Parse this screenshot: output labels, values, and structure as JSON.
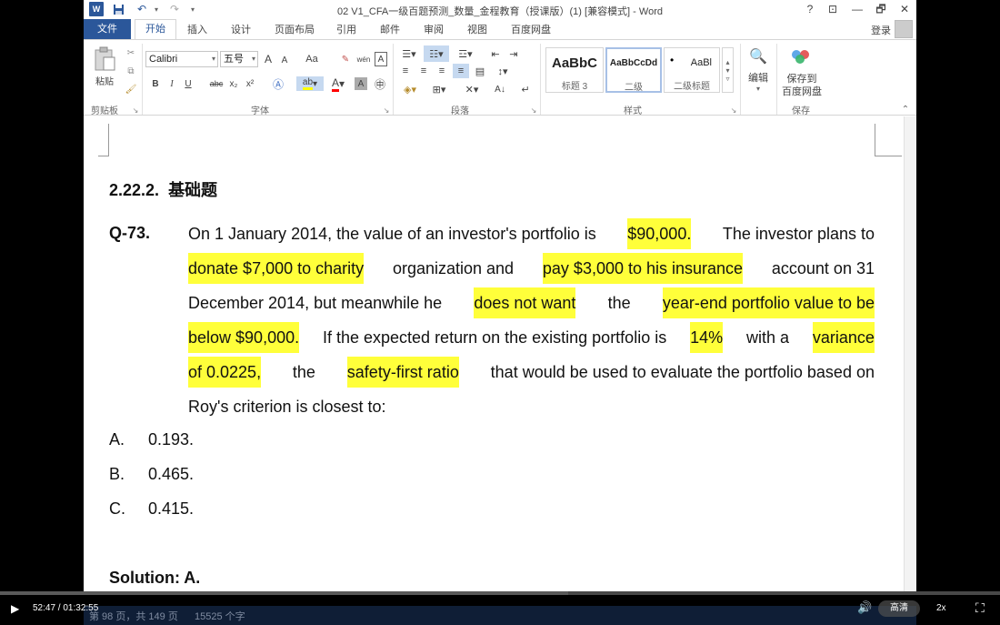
{
  "window": {
    "title": "02 V1_CFA一级百题预测_数量_金程教育（授课版）(1) [兼容模式] - Word",
    "help": "?",
    "buttons": [
      "⊡",
      "—",
      "🗗",
      "✕"
    ]
  },
  "quick_access": {
    "save_icon": "save-icon",
    "undo_icon": "undo-icon",
    "redo_icon": "redo-icon"
  },
  "tabs": [
    "文件",
    "开始",
    "插入",
    "设计",
    "页面布局",
    "引用",
    "邮件",
    "审阅",
    "视图",
    "百度网盘"
  ],
  "active_tab": "开始",
  "login": "登录",
  "ribbon": {
    "clipboard": {
      "paste": "粘贴",
      "label": "剪贴板"
    },
    "font": {
      "font_name": "Calibri",
      "font_size": "五号",
      "grow": "A",
      "shrink": "A",
      "case": "Aa",
      "label": "字体",
      "bold": "B",
      "italic": "I",
      "underline": "U",
      "strike": "abc",
      "sub": "x₂",
      "sup": "x²"
    },
    "paragraph": {
      "label": "段落"
    },
    "styles": {
      "label": "样式",
      "items": [
        {
          "sample": "AaBbC",
          "name": "标题 3"
        },
        {
          "sample": "AaBbCcDd",
          "name": "二级"
        },
        {
          "sample": "AaBl",
          "name": "二级标题"
        }
      ]
    },
    "editing": {
      "label": "编辑"
    },
    "save": {
      "button_line1": "保存到",
      "button_line2": "百度网盘",
      "label": "保存"
    }
  },
  "document": {
    "heading_num": "2.22.2.",
    "heading_text": "基础题",
    "question_number": "Q-73.",
    "question_lines": [
      [
        {
          "t": "On 1 January 2014, the value of an investor's portfolio is",
          "h": false
        },
        {
          "t": "$90,000.",
          "h": true
        },
        {
          "t": "The investor plans to",
          "h": false
        }
      ],
      [
        {
          "t": "donate $7,000 to charity",
          "h": true
        },
        {
          "t": "organization and",
          "h": false
        },
        {
          "t": "pay $3,000 to his insurance",
          "h": true
        },
        {
          "t": "account on 31",
          "h": false
        }
      ],
      [
        {
          "t": "December 2014, but meanwhile he",
          "h": false
        },
        {
          "t": "does not want",
          "h": true
        },
        {
          "t": "the",
          "h": false
        },
        {
          "t": "year-end portfolio value to be",
          "h": true
        }
      ],
      [
        {
          "t": "below $90,000.",
          "h": true
        },
        {
          "t": "If the expected return on the existing portfolio is",
          "h": false
        },
        {
          "t": "14%",
          "h": true
        },
        {
          "t": "with a",
          "h": false
        },
        {
          "t": "variance",
          "h": true
        }
      ],
      [
        {
          "t": "of 0.0225,",
          "h": true
        },
        {
          "t": "the",
          "h": false
        },
        {
          "t": "safety-first ratio",
          "h": true
        },
        {
          "t": "that would be used to evaluate the portfolio based on",
          "h": false
        }
      ],
      [
        {
          "t": "Roy's criterion is closest to:",
          "h": false
        }
      ]
    ],
    "options": [
      {
        "letter": "A.",
        "value": "0.193."
      },
      {
        "letter": "B.",
        "value": "0.465."
      },
      {
        "letter": "C.",
        "value": "0.415."
      }
    ],
    "solution": "Solution: A."
  },
  "status": {
    "page": "第 98 页，共 149 页",
    "words": "15525 个字"
  },
  "player": {
    "time": "52:47 / 01:32:55",
    "progress_fraction": 0.568,
    "quality": "高清",
    "speed": "2x"
  }
}
